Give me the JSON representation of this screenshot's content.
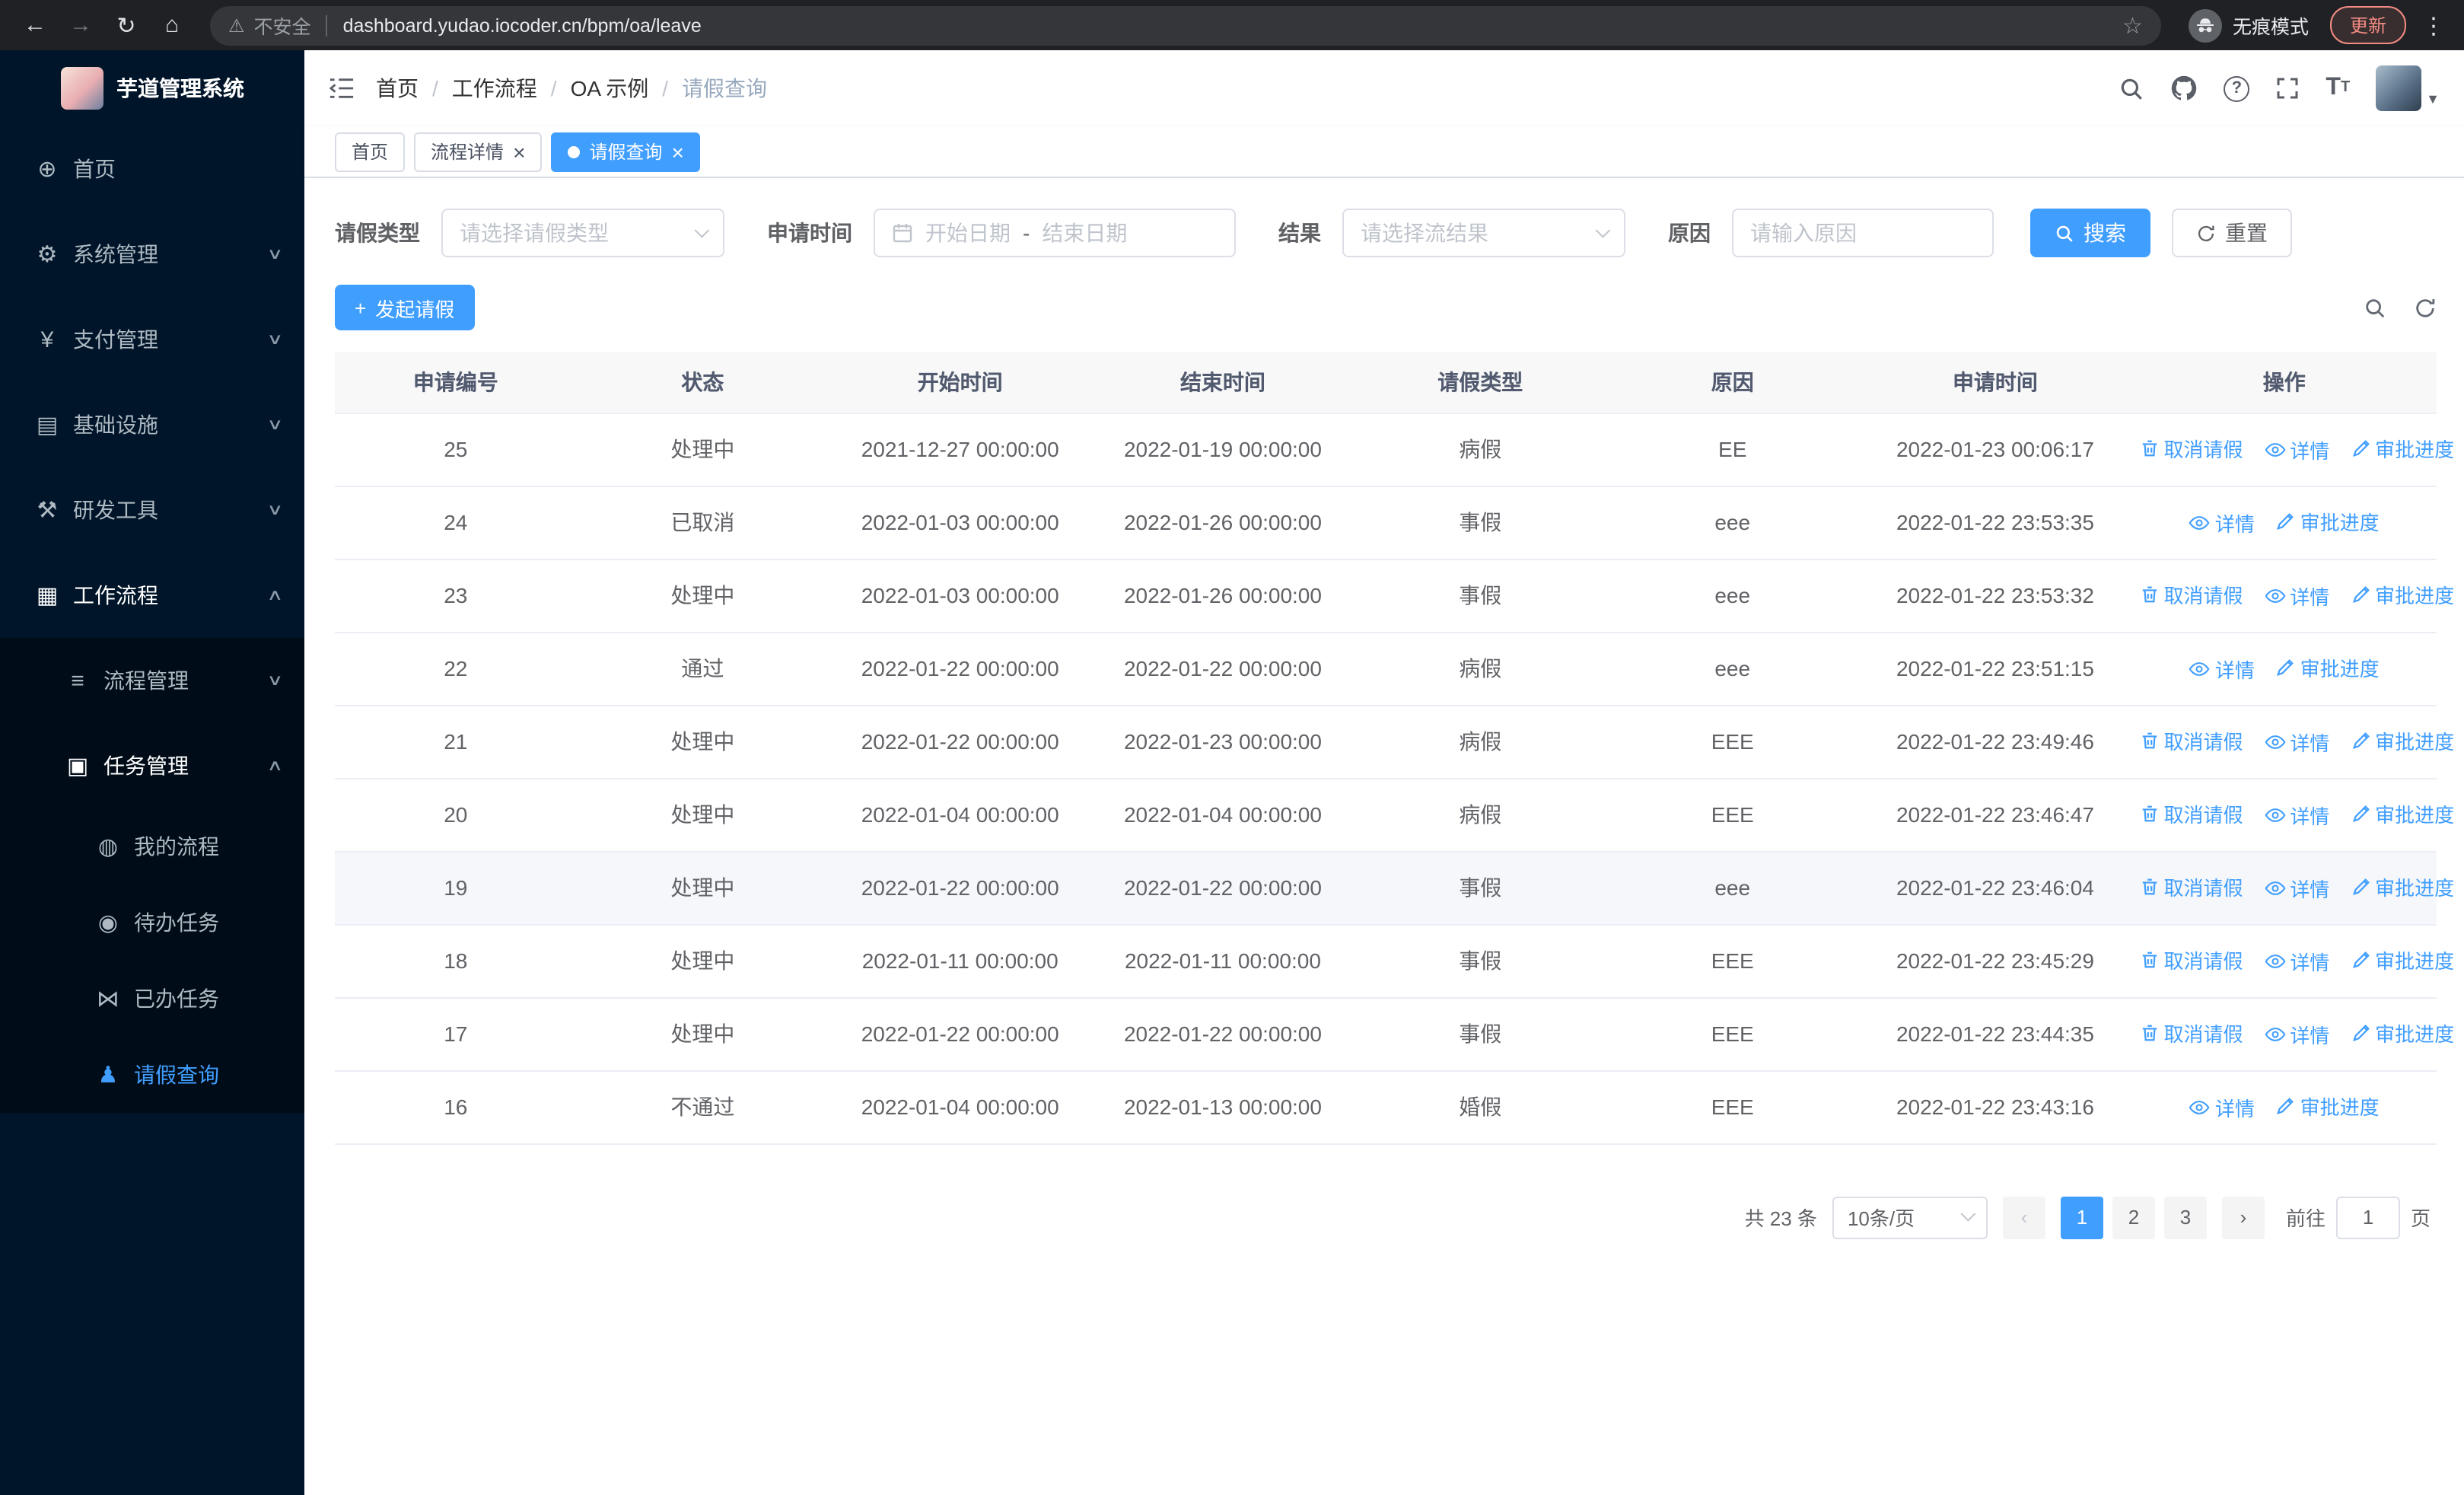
{
  "browser": {
    "security_label": "不安全",
    "url": "dashboard.yudao.iocoder.cn/bpm/oa/leave",
    "incognito_label": "无痕模式",
    "update_label": "更新"
  },
  "sidebar": {
    "logo_title": "芋道管理系统",
    "menu": [
      {
        "label": "首页",
        "icon": "dashboard",
        "level": 1
      },
      {
        "label": "系统管理",
        "icon": "system-gear",
        "level": 1,
        "chevron": "down"
      },
      {
        "label": "支付管理",
        "icon": "payment-yen",
        "level": 1,
        "chevron": "down"
      },
      {
        "label": "基础设施",
        "icon": "infrastructure",
        "level": 1,
        "chevron": "down"
      },
      {
        "label": "研发工具",
        "icon": "dev-tools",
        "level": 1,
        "chevron": "down"
      },
      {
        "label": "工作流程",
        "icon": "workflow",
        "level": 1,
        "chevron": "up",
        "open": true
      },
      {
        "label": "流程管理",
        "icon": "process-mgmt",
        "level": 2,
        "chevron": "down",
        "sub": true
      },
      {
        "label": "任务管理",
        "icon": "task-mgmt",
        "level": 2,
        "chevron": "up",
        "open": true,
        "sub": true
      },
      {
        "label": "我的流程",
        "icon": "my-process",
        "level": 3,
        "sub": true
      },
      {
        "label": "待办任务",
        "icon": "todo-task",
        "level": 3,
        "sub": true
      },
      {
        "label": "已办任务",
        "icon": "done-task",
        "level": 3,
        "sub": true
      },
      {
        "label": "请假查询",
        "icon": "leave-query",
        "level": 3,
        "sub": true,
        "active": true
      }
    ]
  },
  "header": {
    "breadcrumb": [
      {
        "label": "首页"
      },
      {
        "label": "工作流程"
      },
      {
        "label": "OA 示例"
      },
      {
        "label": "请假查询",
        "last": true
      }
    ]
  },
  "tabs": [
    {
      "label": "首页"
    },
    {
      "label": "流程详情",
      "closable": true
    },
    {
      "label": "请假查询",
      "closable": true,
      "active": true
    }
  ],
  "filters": {
    "type_label": "请假类型",
    "type_placeholder": "请选择请假类型",
    "time_label": "申请时间",
    "start_placeholder": "开始日期",
    "range_separator": "-",
    "end_placeholder": "结束日期",
    "result_label": "结果",
    "result_placeholder": "请选择流结果",
    "reason_label": "原因",
    "reason_placeholder": "请输入原因",
    "search_label": "搜索",
    "reset_label": "重置"
  },
  "toolbar": {
    "create_label": "发起请假"
  },
  "table": {
    "columns": [
      "申请编号",
      "状态",
      "开始时间",
      "结束时间",
      "请假类型",
      "原因",
      "申请时间",
      "操作"
    ],
    "actions": {
      "cancel": "取消请假",
      "detail": "详情",
      "progress": "审批进度"
    },
    "rows": [
      {
        "id": "25",
        "status": "处理中",
        "start": "2021-12-27 00:00:00",
        "end": "2022-01-19 00:00:00",
        "type": "病假",
        "reason": "EE",
        "applied": "2022-01-23 00:06:17",
        "can_cancel": true
      },
      {
        "id": "24",
        "status": "已取消",
        "start": "2022-01-03 00:00:00",
        "end": "2022-01-26 00:00:00",
        "type": "事假",
        "reason": "eee",
        "applied": "2022-01-22 23:53:35"
      },
      {
        "id": "23",
        "status": "处理中",
        "start": "2022-01-03 00:00:00",
        "end": "2022-01-26 00:00:00",
        "type": "事假",
        "reason": "eee",
        "applied": "2022-01-22 23:53:32",
        "can_cancel": true
      },
      {
        "id": "22",
        "status": "通过",
        "start": "2022-01-22 00:00:00",
        "end": "2022-01-22 00:00:00",
        "type": "病假",
        "reason": "eee",
        "applied": "2022-01-22 23:51:15"
      },
      {
        "id": "21",
        "status": "处理中",
        "start": "2022-01-22 00:00:00",
        "end": "2022-01-23 00:00:00",
        "type": "病假",
        "reason": "EEE",
        "applied": "2022-01-22 23:49:46",
        "can_cancel": true
      },
      {
        "id": "20",
        "status": "处理中",
        "start": "2022-01-04 00:00:00",
        "end": "2022-01-04 00:00:00",
        "type": "病假",
        "reason": "EEE",
        "applied": "2022-01-22 23:46:47",
        "can_cancel": true
      },
      {
        "id": "19",
        "status": "处理中",
        "start": "2022-01-22 00:00:00",
        "end": "2022-01-22 00:00:00",
        "type": "事假",
        "reason": "eee",
        "applied": "2022-01-22 23:46:04",
        "can_cancel": true,
        "hover": true
      },
      {
        "id": "18",
        "status": "处理中",
        "start": "2022-01-11 00:00:00",
        "end": "2022-01-11 00:00:00",
        "type": "事假",
        "reason": "EEE",
        "applied": "2022-01-22 23:45:29",
        "can_cancel": true
      },
      {
        "id": "17",
        "status": "处理中",
        "start": "2022-01-22 00:00:00",
        "end": "2022-01-22 00:00:00",
        "type": "事假",
        "reason": "EEE",
        "applied": "2022-01-22 23:44:35",
        "can_cancel": true
      },
      {
        "id": "16",
        "status": "不通过",
        "start": "2022-01-04 00:00:00",
        "end": "2022-01-13 00:00:00",
        "type": "婚假",
        "reason": "EEE",
        "applied": "2022-01-22 23:43:16"
      }
    ]
  },
  "pagination": {
    "total_label": "共 23 条",
    "page_size_label": "10条/页",
    "pages": [
      {
        "n": "1",
        "active": true
      },
      {
        "n": "2"
      },
      {
        "n": "3"
      }
    ],
    "goto_label": "前往",
    "goto_value": "1",
    "page_unit": "页"
  },
  "colors": {
    "primary": "#409eff",
    "sidebar_bg": "#001529",
    "submenu_bg": "#000c17"
  }
}
